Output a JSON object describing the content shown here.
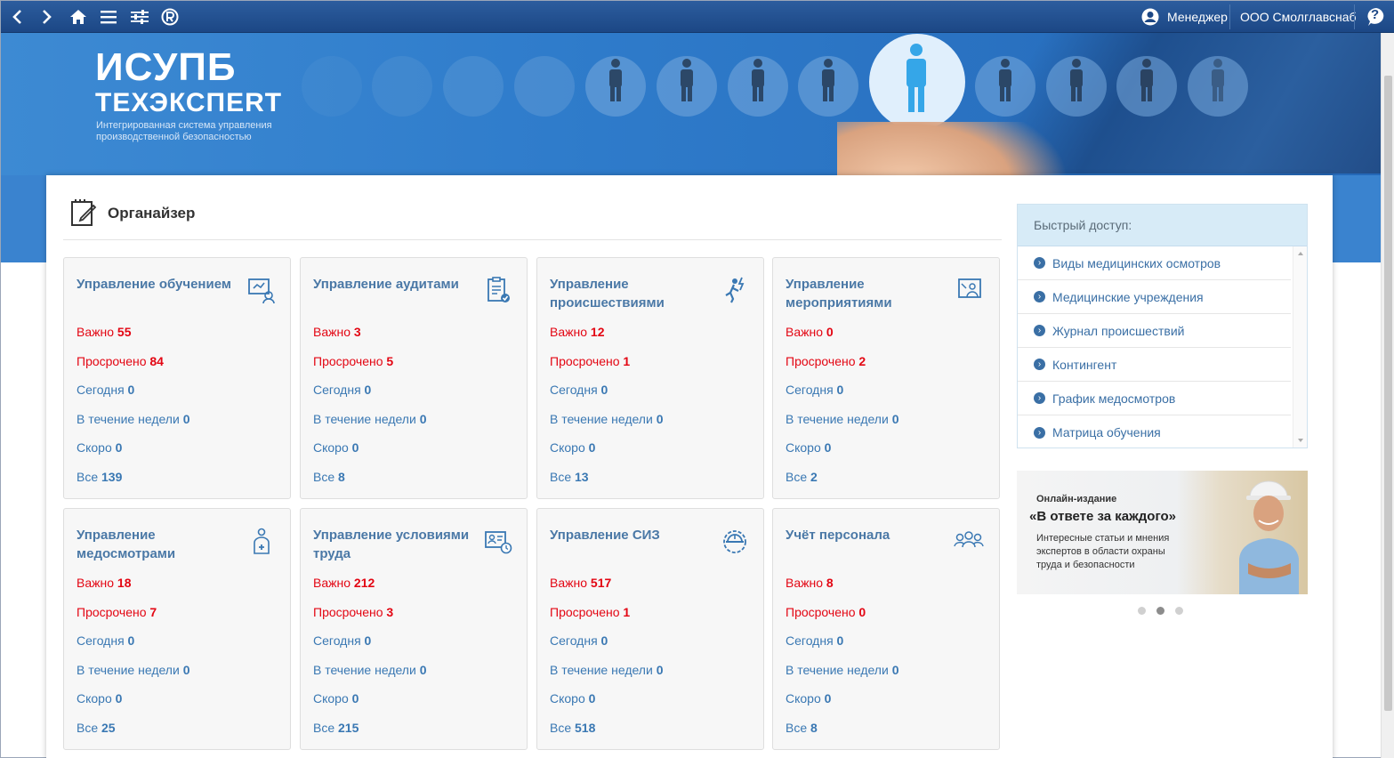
{
  "topbar": {
    "user_label": "Менеджер",
    "org_label": "ООО Смолглавснаб",
    "help_label": "?"
  },
  "banner": {
    "logo_main": "ИСУПБ",
    "logo_sub": "ТЕХЭКСПЕRТ",
    "logo_desc": "Интегрированная система управления производственной безопасностью"
  },
  "organizer": {
    "title": "Органайзер",
    "stat_labels": {
      "important": "Важно",
      "overdue": "Просрочено",
      "today": "Сегодня",
      "week": "В течение недели",
      "soon": "Скоро",
      "all": "Все"
    },
    "cards": [
      {
        "title": "Управление обучением",
        "important": "55",
        "overdue": "84",
        "today": "0",
        "week": "0",
        "soon": "0",
        "all": "139"
      },
      {
        "title": "Управление аудитами",
        "important": "3",
        "overdue": "5",
        "today": "0",
        "week": "0",
        "soon": "0",
        "all": "8"
      },
      {
        "title": "Управление происшествиями",
        "important": "12",
        "overdue": "1",
        "today": "0",
        "week": "0",
        "soon": "0",
        "all": "13"
      },
      {
        "title": "Управление мероприятиями",
        "important": "0",
        "overdue": "2",
        "today": "0",
        "week": "0",
        "soon": "0",
        "all": "2"
      },
      {
        "title": "Управление медосмотрами",
        "important": "18",
        "overdue": "7",
        "today": "0",
        "week": "0",
        "soon": "0",
        "all": "25"
      },
      {
        "title": "Управление условиями труда",
        "important": "212",
        "overdue": "3",
        "today": "0",
        "week": "0",
        "soon": "0",
        "all": "215"
      },
      {
        "title": "Управление СИЗ",
        "important": "517",
        "overdue": "1",
        "today": "0",
        "week": "0",
        "soon": "0",
        "all": "518"
      },
      {
        "title": "Учёт персонала",
        "important": "8",
        "overdue": "0",
        "today": "0",
        "week": "0",
        "soon": "0",
        "all": "8"
      }
    ]
  },
  "quick_access": {
    "title": "Быстрый доступ:",
    "items": [
      "Виды медицинских осмотров",
      "Медицинские учреждения",
      "Журнал происшествий",
      "Контингент",
      "График медосмотров",
      "Матрица обучения"
    ]
  },
  "promo": {
    "line1": "Онлайн-издание",
    "line2": "«В ответе за каждого»",
    "line3": "Интересные статьи и мнения экспертов в области охраны труда и безопасности"
  },
  "colors": {
    "accent_blue": "#3a78b3",
    "alert_red": "#e30613",
    "toolbar": "#1c4785"
  }
}
